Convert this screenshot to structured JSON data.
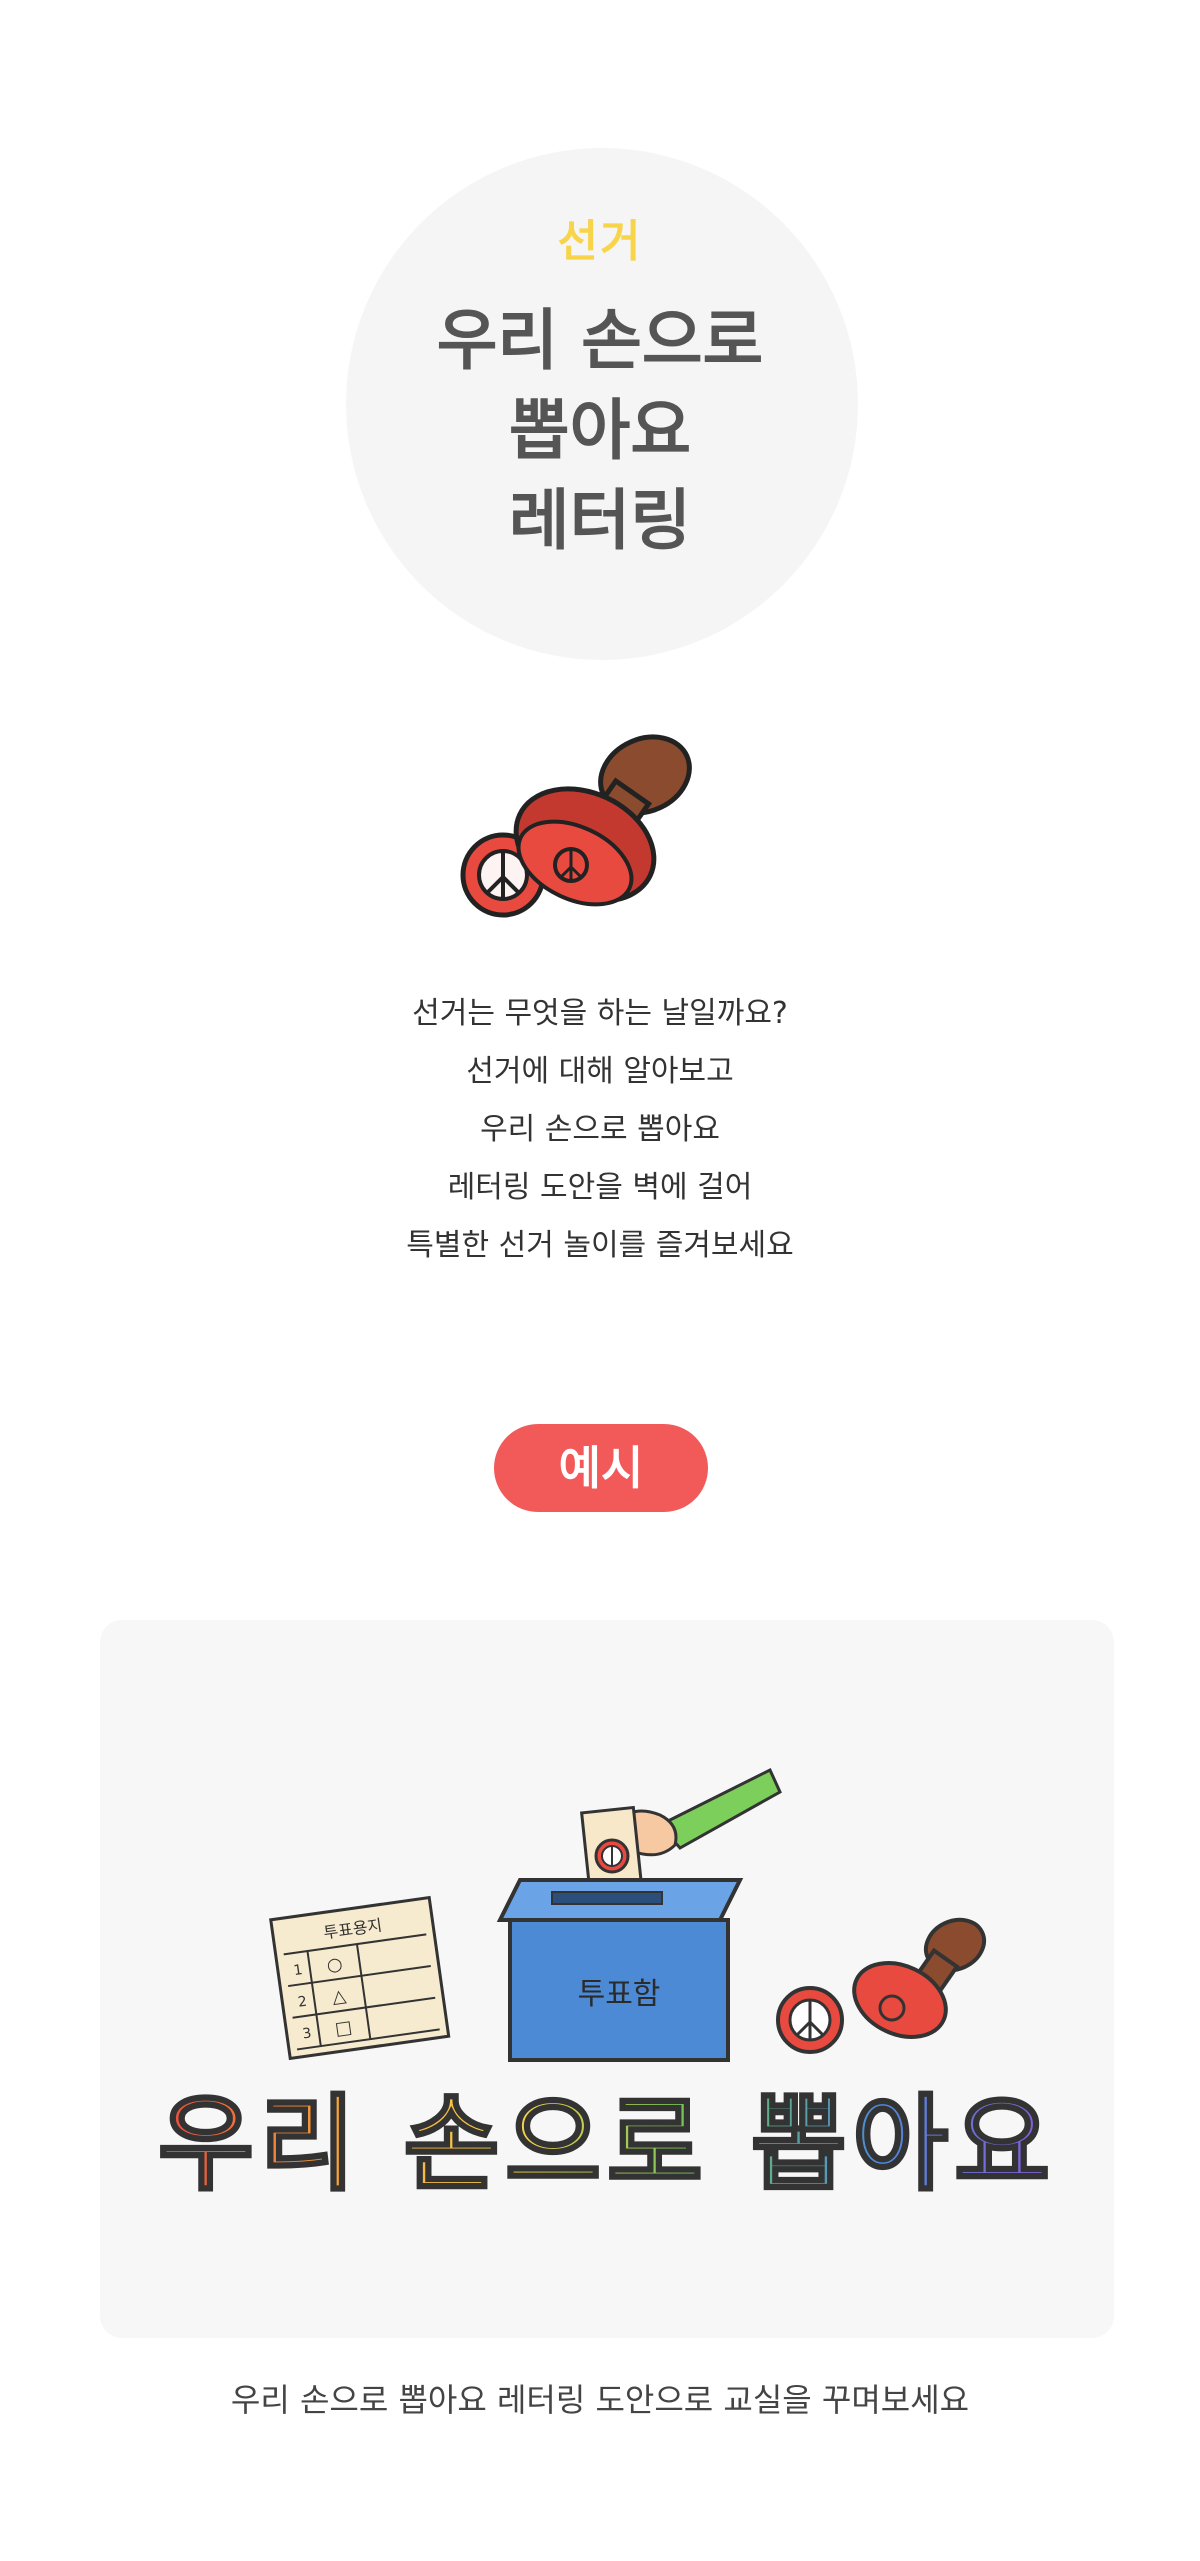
{
  "hero": {
    "category": "선거",
    "title_lines": [
      "우리 손으로",
      "뽑아요",
      "레터링"
    ]
  },
  "intro": {
    "lines": [
      "선거는 무엇을 하는 날일까요?",
      "선거에 대해 알아보고",
      "우리 손으로 뽑아요",
      "레터링 도안을 벽에 걸어",
      "특별한 선거 놀이를 즐겨보세요"
    ]
  },
  "badge": {
    "label": "예시"
  },
  "example": {
    "ballot_paper": {
      "title": "투표용지",
      "numbers": [
        "1",
        "2",
        "3"
      ],
      "marks": [
        "○",
        "△",
        "□"
      ]
    },
    "ballot_box_label": "투표함",
    "lettering": "우리 손으로 뽑아요",
    "caption": "우리 손으로 뽑아요 레터링 도안으로 교실을 꾸며보세요"
  },
  "colors": {
    "category": "#f7d44a",
    "title": "#555555",
    "badge": "#f25a5a",
    "panel": "#f7f7f7",
    "circle": "#f5f5f5"
  }
}
